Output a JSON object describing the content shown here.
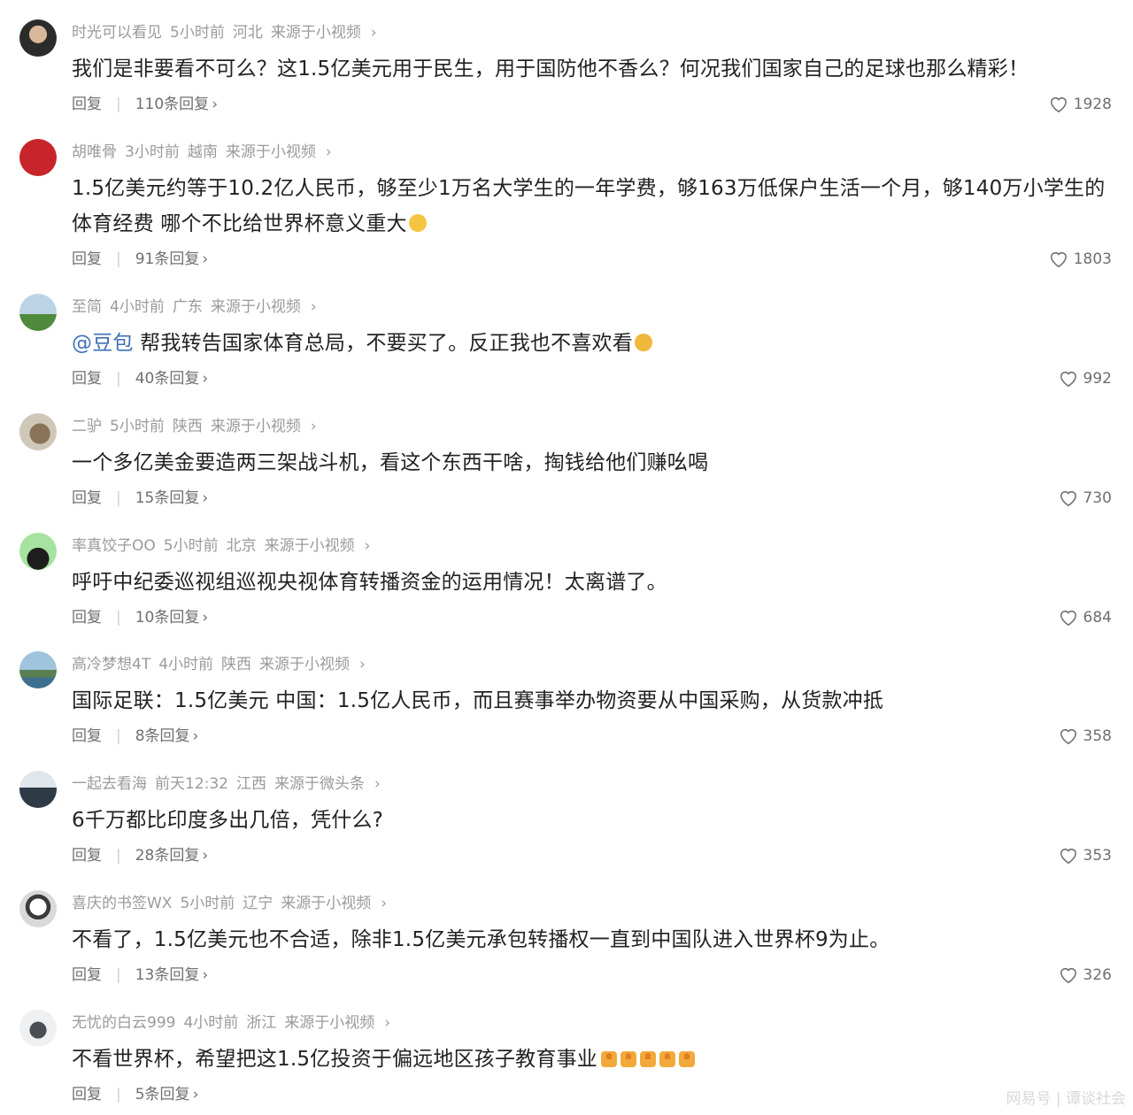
{
  "colors": {
    "meta": "#9a9a9a",
    "text": "#222222",
    "mention": "#3d6fb6",
    "actions": "#6f6f6f"
  },
  "comments": [
    {
      "user": "时光可以看见",
      "time": "5小时前",
      "region": "河北",
      "source": "来源于小视频",
      "text": "我们是非要看不可么？这1.5亿美元用于民生，用于国防他不香么？何况我们国家自己的足球也那么精彩！",
      "reply_label": "回复",
      "replies": "110条回复",
      "likes": "1928"
    },
    {
      "user": "胡唯骨",
      "time": "3小时前",
      "region": "越南",
      "source": "来源于小视频",
      "text": "1.5亿美元约等于10.2亿人民币，够至少1万名大学生的一年学费，够163万低保户生活一个月，够140万小学生的体育经费 哪个不比给世界杯意义重大",
      "reply_label": "回复",
      "replies": "91条回复",
      "likes": "1803"
    },
    {
      "user": "至简",
      "time": "4小时前",
      "region": "广东",
      "source": "来源于小视频",
      "mention": "@豆包",
      "text": " 帮我转告国家体育总局，不要买了。反正我也不喜欢看",
      "reply_label": "回复",
      "replies": "40条回复",
      "likes": "992"
    },
    {
      "user": "二驴",
      "time": "5小时前",
      "region": "陕西",
      "source": "来源于小视频",
      "text": "一个多亿美金要造两三架战斗机，看这个东西干啥，掏钱给他们赚吆喝",
      "reply_label": "回复",
      "replies": "15条回复",
      "likes": "730"
    },
    {
      "user": "率真饺子OO",
      "time": "5小时前",
      "region": "北京",
      "source": "来源于小视频",
      "text": "呼吁中纪委巡视组巡视央视体育转播资金的运用情况！太离谱了。",
      "reply_label": "回复",
      "replies": "10条回复",
      "likes": "684"
    },
    {
      "user": "高冷梦想4T",
      "time": "4小时前",
      "region": "陕西",
      "source": "来源于小视频",
      "text": "国际足联：1.5亿美元 中国：1.5亿人民币，而且赛事举办物资要从中国采购，从货款冲抵",
      "reply_label": "回复",
      "replies": "8条回复",
      "likes": "358"
    },
    {
      "user": "一起去看海",
      "time": "前天12:32",
      "region": "江西",
      "source": "来源于微头条",
      "text": "6千万都比印度多出几倍，凭什么?",
      "reply_label": "回复",
      "replies": "28条回复",
      "likes": "353"
    },
    {
      "user": "喜庆的书签WX",
      "time": "5小时前",
      "region": "辽宁",
      "source": "来源于小视频",
      "text": "不看了，1.5亿美元也不合适，除非1.5亿美元承包转播权一直到中国队进入世界杯9为止。",
      "reply_label": "回复",
      "replies": "13条回复",
      "likes": "326"
    },
    {
      "user": "无忧的白云999",
      "time": "4小时前",
      "region": "浙江",
      "source": "来源于小视频",
      "text": "不看世界杯，希望把这1.5亿投资于偏远地区孩子教育事业",
      "reply_label": "回复",
      "replies": "5条回复",
      "likes": ""
    }
  ],
  "watermark": "网易号 | 谭谈社会"
}
